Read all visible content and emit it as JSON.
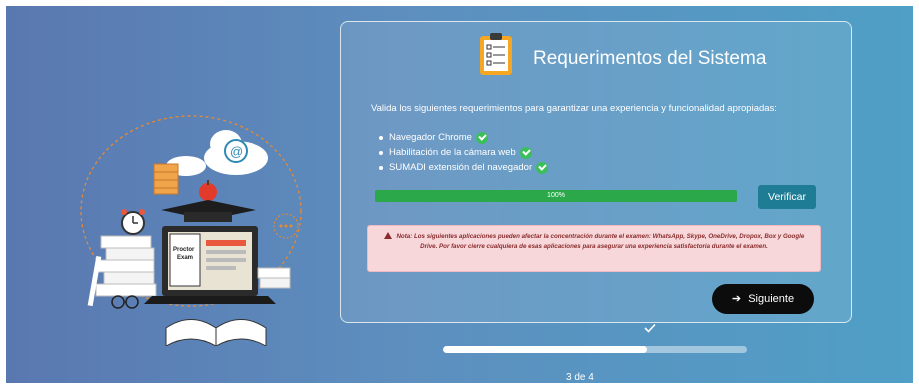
{
  "card": {
    "title": "Requerimentos del Sistema",
    "intro": "Valida los siguientes requerimientos para garantizar una experiencia y funcionalidad apropiadas:",
    "requirements": [
      {
        "label": "Navegador Chrome",
        "status": "ok"
      },
      {
        "label": "Habilitación de la cámara web",
        "status": "ok"
      },
      {
        "label": "SUMADI extensión del navegador",
        "status": "ok"
      }
    ],
    "progress": {
      "value": 1.0,
      "label": "100%"
    },
    "verify_label": "Verificar",
    "note": "Nota: Los siguientes aplicaciones pueden afectar la concentración durante el examen: WhatsApp, Skype, OneDrive, Dropox, Box y Google Drive. Por favor cierre cualquiera de esas aplicaciones para asegurar una experiencia satisfactoria durante el examen.",
    "next_label": "Siguiente"
  },
  "illustration": {
    "laptop_text_line1": "Proctor",
    "laptop_text_line2": "Exam"
  },
  "stepper": {
    "label": "3 de 4",
    "progress": 0.67
  },
  "colors": {
    "accent": "#1e7d95",
    "success": "#2aa84a",
    "warning_bg": "#f8d7da",
    "next_bg": "#0c0c0c"
  }
}
